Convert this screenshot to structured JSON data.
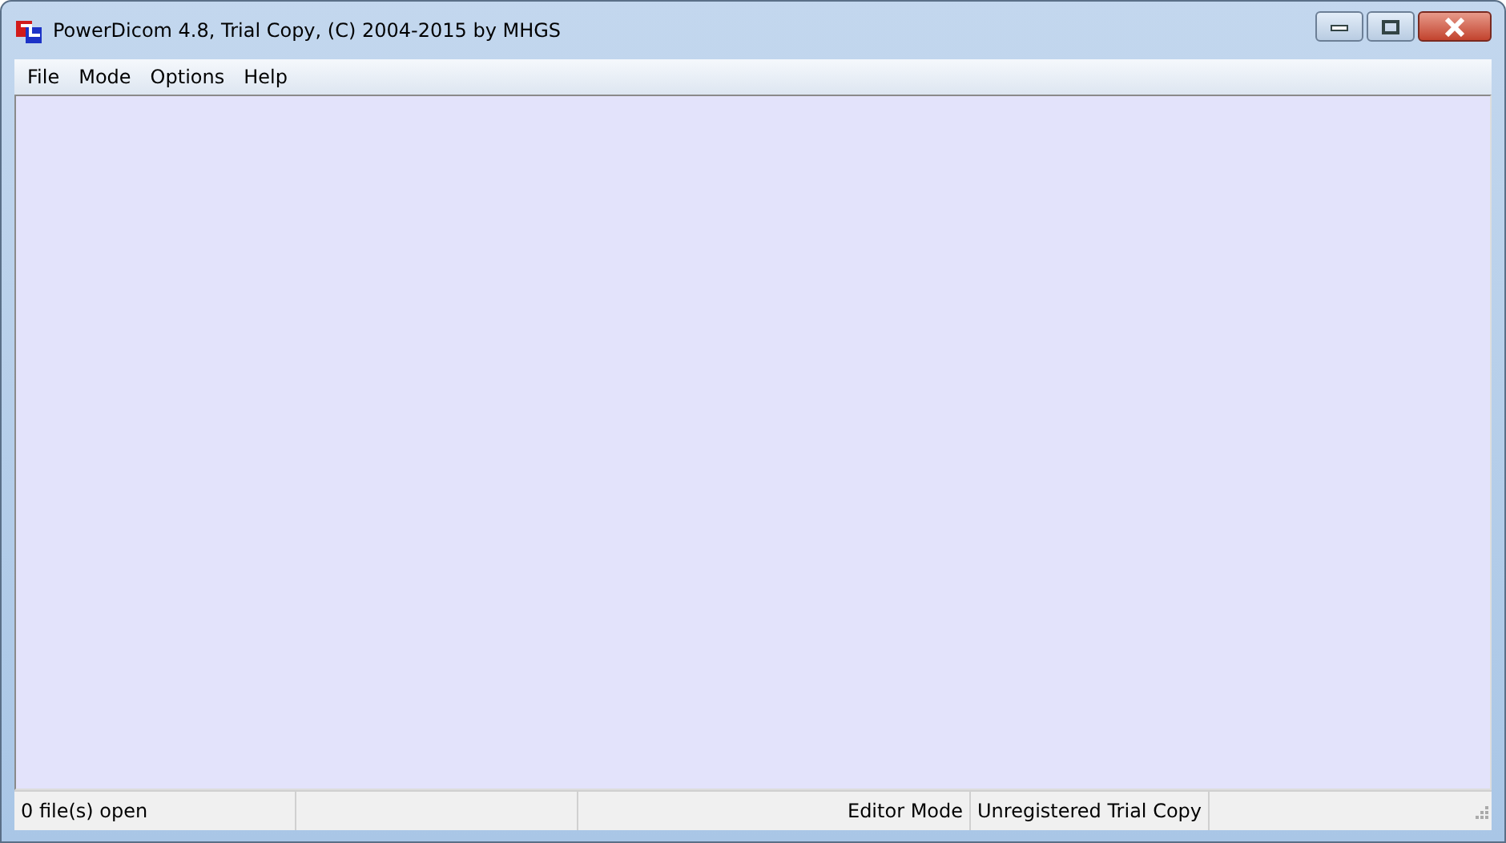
{
  "window": {
    "title": "PowerDicom 4.8, Trial Copy, (C) 2004-2015 by MHGS"
  },
  "menu": [
    "File",
    "Mode",
    "Options",
    "Help"
  ],
  "status_bar": {
    "left": "0 file(s) open",
    "right": [
      "Editor Mode",
      "Unregistered Trial Copy"
    ]
  }
}
